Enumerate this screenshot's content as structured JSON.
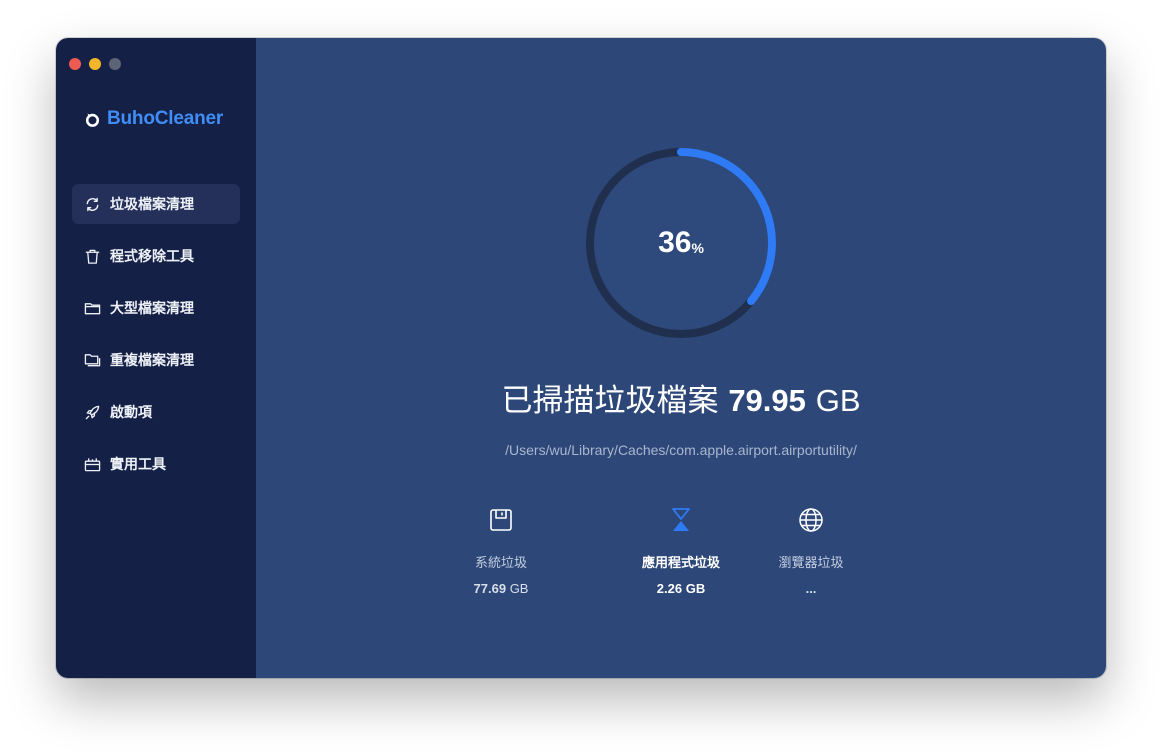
{
  "app": {
    "name": "BuhoCleaner"
  },
  "sidebar": {
    "items": [
      {
        "label": "垃圾檔案清理",
        "icon": "refresh-icon",
        "active": true
      },
      {
        "label": "程式移除工具",
        "icon": "trash-icon",
        "active": false
      },
      {
        "label": "大型檔案清理",
        "icon": "folder-icon",
        "active": false
      },
      {
        "label": "重複檔案清理",
        "icon": "duplicate-folder-icon",
        "active": false
      },
      {
        "label": "啟動項",
        "icon": "rocket-icon",
        "active": false
      },
      {
        "label": "實用工具",
        "icon": "toolbox-icon",
        "active": false
      }
    ]
  },
  "scan": {
    "progress_value": "36",
    "progress_unit": "%",
    "progress_fraction": 0.36,
    "headline_prefix": "已掃描垃圾檔案",
    "amount": "79.95",
    "amount_unit": "GB",
    "current_path": "/Users/wu/Library/Caches/com.apple.airport.airportutility/"
  },
  "categories": [
    {
      "label": "系統垃圾",
      "value": "77.69",
      "unit": "GB",
      "icon": "disk-icon",
      "highlighted": false
    },
    {
      "label": "應用程式垃圾",
      "value": "2.26",
      "unit": "GB",
      "icon": "hourglass-icon",
      "highlighted": true
    },
    {
      "label": "瀏覽器垃圾",
      "value": "...",
      "unit": "",
      "icon": "globe-icon",
      "highlighted": false
    }
  ],
  "colors": {
    "sidebar_bg": "#152046",
    "main_bg": "#2d4878",
    "accent": "#2f7bf6",
    "brand": "#3f8df5"
  }
}
